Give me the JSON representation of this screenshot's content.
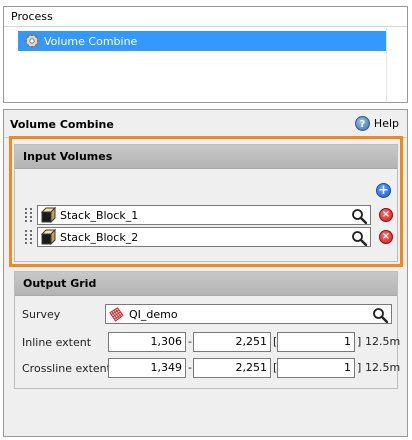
{
  "process": {
    "header": "Process",
    "items": [
      {
        "label": "Volume Combine",
        "icon": "gear-icon",
        "selected": true
      }
    ]
  },
  "panel": {
    "title": "Volume Combine",
    "help_label": "Help",
    "help_icon": "help-icon"
  },
  "input_volumes": {
    "title": "Input Volumes",
    "highlight_color": "#f08a1c",
    "add_icon": "add-icon",
    "items": [
      {
        "name": "Stack_Block_1",
        "icon": "volume-icon"
      },
      {
        "name": "Stack_Block_2",
        "icon": "volume-icon"
      }
    ]
  },
  "output_grid": {
    "title": "Output Grid",
    "survey_label": "Survey",
    "survey_value": "QI_demo",
    "survey_icon": "survey-grid-icon",
    "inline": {
      "label": "Inline extent",
      "from": "1,306",
      "dash": "-",
      "to": "2,251",
      "bracket": "[",
      "step": "1",
      "close": "]",
      "unit": "12.5m"
    },
    "crossline": {
      "label": "Crossline extent",
      "from": "1,349",
      "dash": "-",
      "to": "2,251",
      "bracket": "[",
      "step": "1",
      "close": "]",
      "unit": "12.5m"
    }
  },
  "colors": {
    "selection": "#3399ff",
    "highlight": "#f08a1c"
  }
}
